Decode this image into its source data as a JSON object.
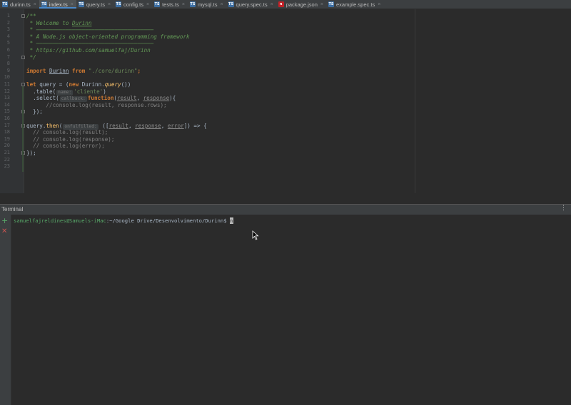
{
  "tabs": [
    {
      "label": "durinn.ts",
      "icon": "ts-file-icon",
      "active": false
    },
    {
      "label": "index.ts",
      "icon": "ts-file-icon",
      "active": true
    },
    {
      "label": "query.ts",
      "icon": "ts-file-icon",
      "active": false
    },
    {
      "label": "config.ts",
      "icon": "ts-file-icon",
      "active": false
    },
    {
      "label": "tests.ts",
      "icon": "ts-file-icon",
      "active": false
    },
    {
      "label": "mysql.ts",
      "icon": "ts-file-icon",
      "active": false
    },
    {
      "label": "query.spec.ts",
      "icon": "ts-file-icon",
      "active": false
    },
    {
      "label": "package.json",
      "icon": "npm-file-icon",
      "active": false
    },
    {
      "label": "example.spec.ts",
      "icon": "ts-file-icon",
      "active": false
    }
  ],
  "editor": {
    "line_numbers": [
      "1",
      "2",
      "3",
      "4",
      "5",
      "6",
      "7",
      "8",
      "9",
      "10",
      "11",
      "12",
      "13",
      "14",
      "15",
      "16",
      "17",
      "18",
      "19",
      "20",
      "21",
      "22",
      "23"
    ],
    "lines": {
      "l1": "/**",
      "l2_a": " * Welcome to ",
      "l2_b": "Durinn",
      "l3": " * ————————————————————————————————————",
      "l4": " * A Node.js object-oriented programming framework",
      "l5": " * ————————————————————————————————————",
      "l6": " * https://github.com/samuelfaj/Durinn",
      "l7": " */",
      "l9_kw1": "import",
      "l9_id": "Durinn",
      "l9_kw2": "from",
      "l9_str": "\"./core/durinn\"",
      "l9_end": ";",
      "l11_kw": "let",
      "l11_a": " query = (",
      "l11_kw2": "new",
      "l11_b": " Durinn.",
      "l11_fn": "query",
      "l11_c": "())",
      "l12_a": "  .table(",
      "l12_hint": "name:",
      "l12_str": "'cliente'",
      "l12_b": ")",
      "l13_a": "  .select(",
      "l13_hint": "callback:",
      "l13_kw": "function",
      "l13_b": "(",
      "l13_p1": "result",
      "l13_c": ", ",
      "l13_p2": "response",
      "l13_d": "){",
      "l14": "      //console.log(result, response.rows);",
      "l15": "  });",
      "l17_a": "query.",
      "l17_fn": "then",
      "l17_b": "(",
      "l17_hint": "onfulfilled:",
      "l17_c": " ([",
      "l17_p1": "result",
      "l17_d": ", ",
      "l17_p2": "response",
      "l17_e": ", ",
      "l17_p3": "error",
      "l17_f": "]) => {",
      "l18": "  // console.log(result);",
      "l19": "  // console.log(response);",
      "l20": "  // console.log(error);",
      "l21": "});"
    }
  },
  "terminal": {
    "title": "Terminal",
    "menu_icon": "⋮",
    "user_host": "samuelfajreldines@Samuels-iMac",
    "path": ":~/Google Drive/Desenvolvimento/Durinn$",
    "typed": "n",
    "add_icon": "+",
    "close_icon": "✕"
  }
}
